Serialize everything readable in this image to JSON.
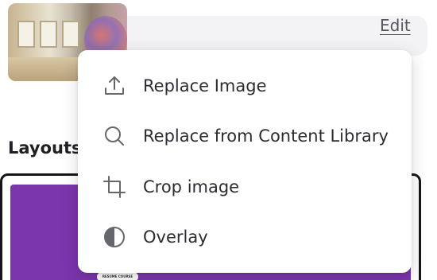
{
  "header": {
    "edit_label": "Edit"
  },
  "layouts": {
    "heading": "Layouts",
    "badge_text": "RESUME COURSE"
  },
  "menu": {
    "items": [
      {
        "label": "Replace Image",
        "icon": "upload-icon"
      },
      {
        "label": "Replace from Content Library",
        "icon": "search-icon"
      },
      {
        "label": "Crop image",
        "icon": "crop-icon"
      },
      {
        "label": "Overlay",
        "icon": "contrast-icon"
      }
    ]
  },
  "colors": {
    "accent_purple": "#7b35ad",
    "icon_gray": "#66676d"
  }
}
